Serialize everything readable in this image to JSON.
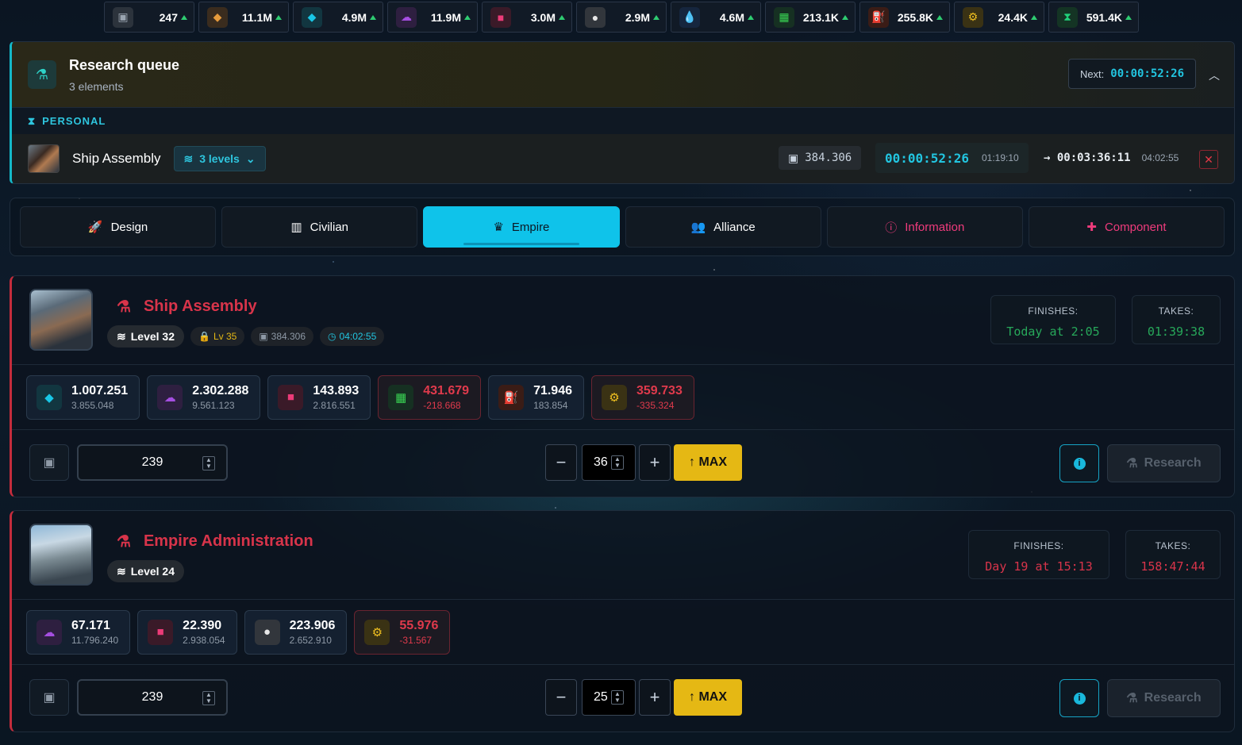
{
  "resources": [
    {
      "name": "robot-icon",
      "glyph": "▣",
      "color": "#9aa5b1",
      "bg": "#2c333c",
      "value": "247"
    },
    {
      "name": "diamond-orange-icon",
      "glyph": "◆",
      "color": "#e59a3c",
      "bg": "#3a2c1e",
      "value": "11.1M"
    },
    {
      "name": "crystal-cyan-icon",
      "glyph": "◆",
      "color": "#19c6e6",
      "bg": "#123640",
      "value": "4.9M"
    },
    {
      "name": "cloud-purple-icon",
      "glyph": "☁",
      "color": "#a54ee0",
      "bg": "#2e1f40",
      "value": "11.9M"
    },
    {
      "name": "cube-pink-icon",
      "glyph": "■",
      "color": "#ec3b78",
      "bg": "#3a1a28",
      "value": "3.0M"
    },
    {
      "name": "sphere-white-icon",
      "glyph": "●",
      "color": "#e6e6e6",
      "bg": "#32363c",
      "value": "2.9M"
    },
    {
      "name": "drop-blue-icon",
      "glyph": "💧",
      "color": "#3a8cf0",
      "bg": "#16263e",
      "value": "4.6M"
    },
    {
      "name": "chip-green-icon",
      "glyph": "▦",
      "color": "#39d353",
      "bg": "#163022",
      "value": "213.1K"
    },
    {
      "name": "fuel-red-icon",
      "glyph": "⛽",
      "color": "#f0502c",
      "bg": "#3a1c16",
      "value": "255.8K"
    },
    {
      "name": "gear-yellow-icon",
      "glyph": "⚙",
      "color": "#f0c020",
      "bg": "#3a3214",
      "value": "24.4K"
    },
    {
      "name": "hourglass-green-icon",
      "glyph": "⧗",
      "color": "#21d07a",
      "bg": "#143424",
      "value": "591.4K"
    }
  ],
  "queue": {
    "title": "Research queue",
    "subtitle": "3 elements",
    "next_label": "Next:",
    "next_time": "00:00:52:26",
    "section": "PERSONAL",
    "item": {
      "name": "Ship Assembly",
      "levels": "3 levels",
      "cost": "384.306",
      "time": "00:00:52:26",
      "time_sub": "01:19:10",
      "end": "00:03:36:11",
      "end_sub": "04:02:55"
    }
  },
  "tabs": [
    {
      "label": "Design",
      "glyph": "🚀",
      "name": "tab-design"
    },
    {
      "label": "Civilian",
      "glyph": "▥",
      "name": "tab-civilian"
    },
    {
      "label": "Empire",
      "glyph": "♛",
      "name": "tab-empire"
    },
    {
      "label": "Alliance",
      "glyph": "👥",
      "name": "tab-alliance"
    },
    {
      "label": "Information",
      "glyph": "ⓘ",
      "name": "tab-information"
    },
    {
      "label": "Component",
      "glyph": "✚",
      "name": "tab-component"
    }
  ],
  "cards": [
    {
      "title": "Ship Assembly",
      "level": "Level 32",
      "req_level": "Lv 35",
      "req_cost": "384.306",
      "req_time": "04:02:55",
      "finishes_label": "FINISHES:",
      "finishes": "Today at 2:05",
      "takes_label": "TAKES:",
      "takes": "01:39:38",
      "costs": [
        {
          "icon": "crystal-cyan-icon",
          "a": "1.007.251",
          "b": "3.855.048",
          "bad": false
        },
        {
          "icon": "cloud-purple-icon",
          "a": "2.302.288",
          "b": "9.561.123",
          "bad": false
        },
        {
          "icon": "cube-pink-icon",
          "a": "143.893",
          "b": "2.816.551",
          "bad": false
        },
        {
          "icon": "chip-green-icon",
          "a": "431.679",
          "b": "-218.668",
          "bad": true
        },
        {
          "icon": "fuel-red-icon",
          "a": "71.946",
          "b": "183.854",
          "bad": false
        },
        {
          "icon": "gear-yellow-icon",
          "a": "359.733",
          "b": "-335.324",
          "bad": true
        }
      ],
      "workers": "239",
      "target_level": "36",
      "max_label": "MAX",
      "research_label": "Research"
    },
    {
      "title": "Empire Administration",
      "level": "Level 24",
      "finishes_label": "FINISHES:",
      "finishes": "Day 19 at 15:13",
      "takes_label": "TAKES:",
      "takes": "158:47:44",
      "costs": [
        {
          "icon": "cloud-purple-icon",
          "a": "67.171",
          "b": "11.796.240",
          "bad": false
        },
        {
          "icon": "cube-pink-icon",
          "a": "22.390",
          "b": "2.938.054",
          "bad": false
        },
        {
          "icon": "sphere-white-icon",
          "a": "223.906",
          "b": "2.652.910",
          "bad": false
        },
        {
          "icon": "gear-yellow-icon",
          "a": "55.976",
          "b": "-31.567",
          "bad": true
        }
      ],
      "workers": "239",
      "target_level": "25",
      "max_label": "MAX",
      "research_label": "Research"
    }
  ]
}
